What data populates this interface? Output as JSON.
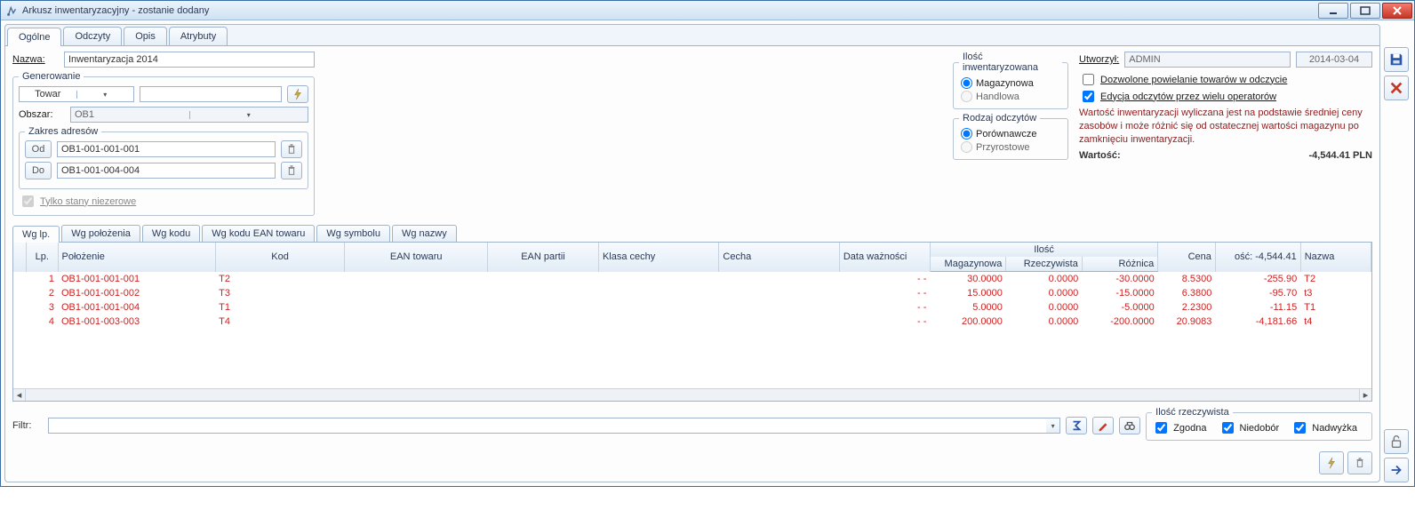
{
  "window": {
    "title": "Arkusz inwentaryzacyjny - zostanie dodany"
  },
  "tabs": [
    "Ogólne",
    "Odczyty",
    "Opis",
    "Atrybuty"
  ],
  "tabs_active": 0,
  "form": {
    "nazwa_label": "Nazwa:",
    "nazwa_value": "Inwentaryzacja 2014",
    "gen_legend": "Generowanie",
    "gen_type": "Towar",
    "obszar_label": "Obszar:",
    "obszar_value": "OB1",
    "zakres_legend": "Zakres adresów",
    "od_label": "Od",
    "od_value": "OB1-001-001-001",
    "do_label": "Do",
    "do_value": "OB1-001-004-004",
    "tylko_label": "Tylko stany niezerowe"
  },
  "qty": {
    "legend": "Ilość inwentaryzowana",
    "magazynowa": "Magazynowa",
    "handlowa": "Handlowa",
    "selected": "magazynowa"
  },
  "read": {
    "legend": "Rodzaj odczytów",
    "porownawcze": "Porównawcze",
    "przyrostowe": "Przyrostowe",
    "selected": "porownawcze"
  },
  "meta": {
    "utworzyl_label": "Utworzył:",
    "utworzyl_value": "ADMIN",
    "data": "2014-03-04",
    "chk_powielanie": "Dozwolone powielanie towarów w odczycie",
    "chk_edycja": "Edycja odczytów przez wielu operatorów",
    "note": "Wartość inwentaryzacji wyliczana jest na podstawie średniej ceny zasobów i może różnić się od ostatecznej wartości magazynu po zamknięciu inwentaryzacji.",
    "wartosc_label": "Wartość:",
    "wartosc_value": "-4,544.41 PLN"
  },
  "tabs2": [
    "Wg lp.",
    "Wg położenia",
    "Wg kodu",
    "Wg kodu EAN towaru",
    "Wg symbolu",
    "Wg nazwy"
  ],
  "tabs2_active": 0,
  "grid": {
    "group_ilosc": "Ilość",
    "headers": {
      "lp": "Lp.",
      "polozenie": "Położenie",
      "kod": "Kod",
      "ean": "EAN towaru",
      "ean_partii": "EAN partii",
      "klasa": "Klasa cechy",
      "cecha": "Cecha",
      "data_w": "Data ważności",
      "il_mag": "Magazynowa",
      "il_rzecz": "Rzeczywista",
      "il_rozn": "Różnica",
      "cena": "Cena",
      "osc": "ość: -4,544.41",
      "nazwa": "Nazwa"
    },
    "rows": [
      {
        "lp": "1",
        "pol": "OB1-001-001-001",
        "kod": "T2",
        "dw": "- -",
        "mag": "30.0000",
        "rzecz": "0.0000",
        "rozn": "-30.0000",
        "cena": "8.5300",
        "osc": "-255.90",
        "nazwa": "T2"
      },
      {
        "lp": "2",
        "pol": "OB1-001-001-002",
        "kod": "T3",
        "dw": "- -",
        "mag": "15.0000",
        "rzecz": "0.0000",
        "rozn": "-15.0000",
        "cena": "6.3800",
        "osc": "-95.70",
        "nazwa": "t3"
      },
      {
        "lp": "3",
        "pol": "OB1-001-001-004",
        "kod": "T1",
        "dw": "- -",
        "mag": "5.0000",
        "rzecz": "0.0000",
        "rozn": "-5.0000",
        "cena": "2.2300",
        "osc": "-11.15",
        "nazwa": "T1"
      },
      {
        "lp": "4",
        "pol": "OB1-001-003-003",
        "kod": "T4",
        "dw": "- -",
        "mag": "200.0000",
        "rzecz": "0.0000",
        "rozn": "-200.0000",
        "cena": "20.9083",
        "osc": "-4,181.66",
        "nazwa": "t4"
      }
    ]
  },
  "filter": {
    "label": "Filtr:",
    "value": ""
  },
  "real": {
    "legend": "Ilość rzeczywista",
    "zgodna": "Zgodna",
    "niedobor": "Niedobór",
    "nadwyzka": "Nadwyżka"
  }
}
